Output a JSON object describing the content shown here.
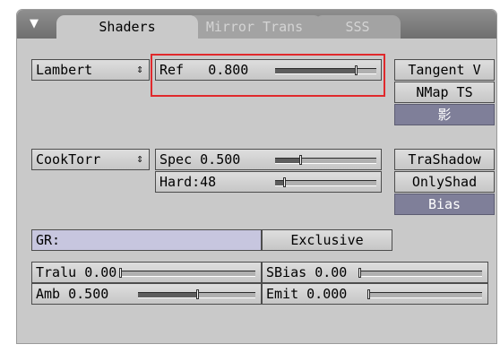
{
  "tabs": [
    {
      "label": "Shaders",
      "active": true
    },
    {
      "label": "Mirror Trans"
    },
    {
      "label": "SSS"
    }
  ],
  "diffuse_shader": {
    "label": "Lambert",
    "icon": "updown-arrows-icon"
  },
  "ref": {
    "label": "Ref",
    "value": "0.800",
    "fraction": 0.8
  },
  "specular_shader": {
    "label": "CookTorr",
    "icon": "updown-arrows-icon"
  },
  "spec": {
    "label": "Spec",
    "value": "0.500",
    "fraction": 0.25
  },
  "hard": {
    "label": "Hard:48",
    "fraction": 0.09
  },
  "right_buttons": {
    "tangent": "Tangent V",
    "nmap": "NMap TS",
    "shadow_symbol": "影",
    "tra_shadow": "TraShadow",
    "only_shad": "OnlyShad",
    "bias": "Bias"
  },
  "group": {
    "label": "GR:",
    "exclusive": "Exclusive"
  },
  "tralu": {
    "label": "Tralu",
    "value": "0.00",
    "fraction": 0.0
  },
  "sbias": {
    "label": "SBias",
    "value": "0.00",
    "fraction": 0.0
  },
  "amb": {
    "label": "Amb",
    "value": "0.500",
    "fraction": 0.5
  },
  "emit": {
    "label": "Emit",
    "value": "0.000",
    "fraction": 0.0
  },
  "colors": {
    "highlight": "#e0292c",
    "panel": "#c9c9c9",
    "active_button": "#7f7f99"
  }
}
